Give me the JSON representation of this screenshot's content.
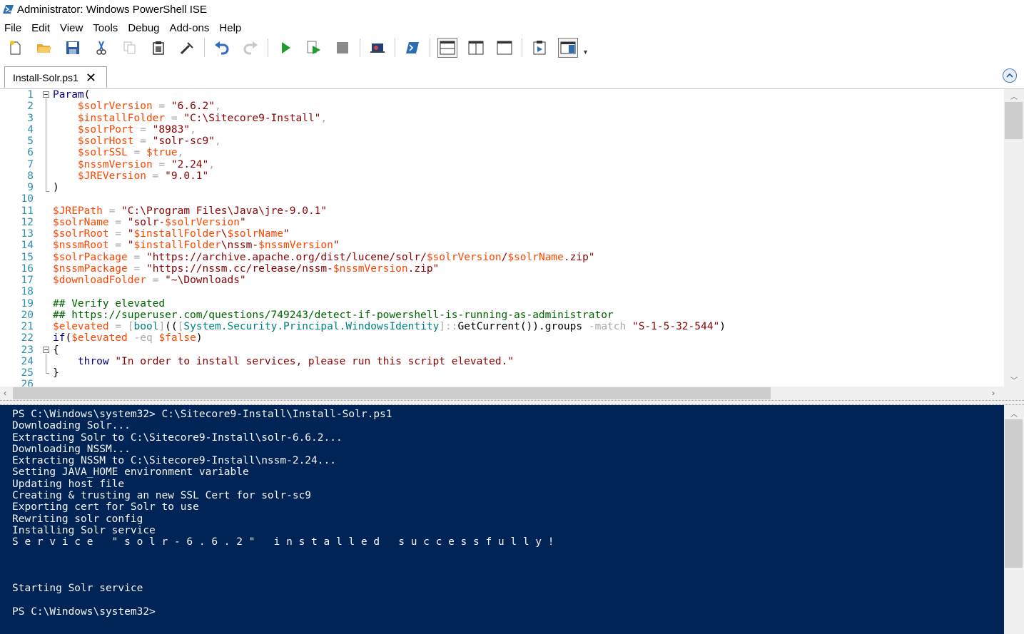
{
  "window": {
    "title": "Administrator: Windows PowerShell ISE"
  },
  "menu": [
    "File",
    "Edit",
    "View",
    "Tools",
    "Debug",
    "Add-ons",
    "Help"
  ],
  "toolbar_icons": [
    "new-icon",
    "open-icon",
    "save-icon",
    "cut-icon",
    "copy-icon",
    "paste-icon",
    "clear-console-icon",
    "undo-icon",
    "redo-icon",
    "run-icon",
    "run-selection-icon",
    "stop-icon",
    "remote-powershell-icon",
    "powershell-console-icon",
    "show-script-top-icon",
    "show-script-right-icon",
    "show-script-max-icon",
    "show-command-window-icon",
    "show-command-addon-icon"
  ],
  "tab": {
    "label": "Install-Solr.ps1"
  },
  "editor": {
    "line_numbers": [
      "1",
      "2",
      "3",
      "4",
      "5",
      "6",
      "7",
      "8",
      "9",
      "10",
      "11",
      "12",
      "13",
      "14",
      "15",
      "16",
      "17",
      "18",
      "19",
      "20",
      "21",
      "22",
      "23",
      "24",
      "25",
      "26"
    ],
    "lines": [
      [
        [
          "kw",
          "Param"
        ],
        [
          "plain",
          "("
        ]
      ],
      [
        [
          "plain",
          "    "
        ],
        [
          "var",
          "$solrVersion"
        ],
        [
          "op",
          " = "
        ],
        [
          "str",
          "\"6.6.2\""
        ],
        [
          "op",
          ","
        ]
      ],
      [
        [
          "plain",
          "    "
        ],
        [
          "var",
          "$installFolder"
        ],
        [
          "op",
          " = "
        ],
        [
          "str",
          "\"C:\\Sitecore9-Install\""
        ],
        [
          "op",
          ","
        ]
      ],
      [
        [
          "plain",
          "    "
        ],
        [
          "var",
          "$solrPort"
        ],
        [
          "op",
          " = "
        ],
        [
          "str",
          "\"8983\""
        ],
        [
          "op",
          ","
        ]
      ],
      [
        [
          "plain",
          "    "
        ],
        [
          "var",
          "$solrHost"
        ],
        [
          "op",
          " = "
        ],
        [
          "str",
          "\"solr-sc9\""
        ],
        [
          "op",
          ","
        ]
      ],
      [
        [
          "plain",
          "    "
        ],
        [
          "var",
          "$solrSSL"
        ],
        [
          "op",
          " = "
        ],
        [
          "var",
          "$true"
        ],
        [
          "op",
          ","
        ]
      ],
      [
        [
          "plain",
          "    "
        ],
        [
          "var",
          "$nssmVersion"
        ],
        [
          "op",
          " = "
        ],
        [
          "str",
          "\"2.24\""
        ],
        [
          "op",
          ","
        ]
      ],
      [
        [
          "plain",
          "    "
        ],
        [
          "var",
          "$JREVersion"
        ],
        [
          "op",
          " = "
        ],
        [
          "str",
          "\"9.0.1\""
        ]
      ],
      [
        [
          "plain",
          ")"
        ]
      ],
      [],
      [
        [
          "var",
          "$JREPath"
        ],
        [
          "op",
          " = "
        ],
        [
          "str",
          "\"C:\\Program Files\\Java\\jre-9.0.1\""
        ]
      ],
      [
        [
          "var",
          "$solrName"
        ],
        [
          "op",
          " = "
        ],
        [
          "str",
          "\"solr-"
        ],
        [
          "var",
          "$solrVersion"
        ],
        [
          "str",
          "\""
        ]
      ],
      [
        [
          "var",
          "$solrRoot"
        ],
        [
          "op",
          " = "
        ],
        [
          "str",
          "\""
        ],
        [
          "var",
          "$installFolder"
        ],
        [
          "str",
          "\\"
        ],
        [
          "var",
          "$solrName"
        ],
        [
          "str",
          "\""
        ]
      ],
      [
        [
          "var",
          "$nssmRoot"
        ],
        [
          "op",
          " = "
        ],
        [
          "str",
          "\""
        ],
        [
          "var",
          "$installFolder"
        ],
        [
          "str",
          "\\nssm-"
        ],
        [
          "var",
          "$nssmVersion"
        ],
        [
          "str",
          "\""
        ]
      ],
      [
        [
          "var",
          "$solrPackage"
        ],
        [
          "op",
          " = "
        ],
        [
          "str",
          "\"https://archive.apache.org/dist/lucene/solr/"
        ],
        [
          "var",
          "$solrVersion"
        ],
        [
          "str",
          "/"
        ],
        [
          "var",
          "$solrName"
        ],
        [
          "str",
          ".zip\""
        ]
      ],
      [
        [
          "var",
          "$nssmPackage"
        ],
        [
          "op",
          " = "
        ],
        [
          "str",
          "\"https://nssm.cc/release/nssm-"
        ],
        [
          "var",
          "$nssmVersion"
        ],
        [
          "str",
          ".zip\""
        ]
      ],
      [
        [
          "var",
          "$downloadFolder"
        ],
        [
          "op",
          " = "
        ],
        [
          "str",
          "\"~\\Downloads\""
        ]
      ],
      [],
      [
        [
          "cmt",
          "## Verify elevated"
        ]
      ],
      [
        [
          "cmt",
          "## https://superuser.com/questions/749243/detect-if-powershell-is-running-as-administrator"
        ]
      ],
      [
        [
          "var",
          "$elevated"
        ],
        [
          "op",
          " = "
        ],
        [
          "op",
          "["
        ],
        [
          "type",
          "bool"
        ],
        [
          "op",
          "]"
        ],
        [
          "plain",
          "(("
        ],
        [
          "op",
          "["
        ],
        [
          "type",
          "System.Security.Principal.WindowsIdentity"
        ],
        [
          "op",
          "]::"
        ],
        [
          "member",
          "GetCurrent"
        ],
        [
          "plain",
          "())."
        ],
        [
          "member",
          "groups"
        ],
        [
          "op",
          " -match "
        ],
        [
          "str",
          "\"S-1-5-32-544\""
        ],
        [
          "plain",
          ")"
        ]
      ],
      [
        [
          "kw",
          "if"
        ],
        [
          "plain",
          "("
        ],
        [
          "var",
          "$elevated"
        ],
        [
          "op",
          " -eq "
        ],
        [
          "var",
          "$false"
        ],
        [
          "plain",
          ")"
        ]
      ],
      [
        [
          "plain",
          "{"
        ]
      ],
      [
        [
          "plain",
          "    "
        ],
        [
          "kw",
          "throw"
        ],
        [
          "plain",
          " "
        ],
        [
          "str",
          "\"In order to install services, please run this script elevated.\""
        ]
      ],
      [
        [
          "plain",
          "}"
        ]
      ],
      []
    ]
  },
  "console": {
    "lines": [
      "PS C:\\Windows\\system32> C:\\Sitecore9-Install\\Install-Solr.ps1",
      "Downloading Solr...",
      "Extracting Solr to C:\\Sitecore9-Install\\solr-6.6.2...",
      "Downloading NSSM...",
      "Extracting NSSM to C:\\Sitecore9-Install\\nssm-2.24...",
      "Setting JAVA_HOME environment variable",
      "Updating host file",
      "Creating & trusting an new SSL Cert for solr-sc9",
      "Exporting cert for Solr to use",
      "Rewriting solr config",
      "Installing Solr service",
      "S e r v i c e   \" s o l r - 6 . 6 . 2 \"   i n s t a l l e d   s u c c e s s f u l l y !",
      "",
      "",
      "",
      "Starting Solr service",
      "",
      "PS C:\\Windows\\system32>"
    ]
  }
}
